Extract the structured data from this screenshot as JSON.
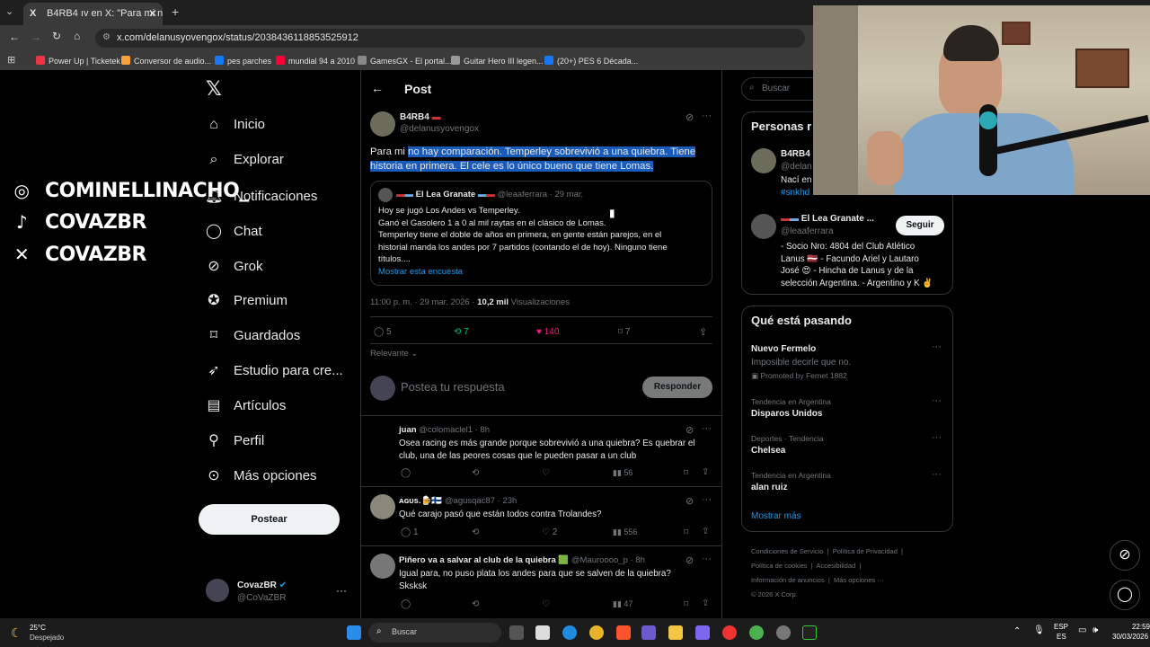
{
  "browser": {
    "tab_title": "B4RB4 ıv en X: \"Para mi no hay",
    "url": "x.com/delanusyovengox/status/2038436118853525912",
    "bookmarks": [
      "Power Up | Ticketek",
      "Conversor de audio...",
      "pes parches",
      "mundial 94 a 2010",
      "GamesGX - El portal...",
      "Guitar Hero III legen...",
      "(20+) PES 6 Década..."
    ]
  },
  "overlay": {
    "instagram": "COMINELLINACHO_",
    "tiktok": "COVAZBR",
    "x": "COVAZBR"
  },
  "nav": {
    "items": [
      "Inicio",
      "Explorar",
      "Notificaciones",
      "Chat",
      "Grok",
      "Premium",
      "Guardados",
      "Estudio para cre...",
      "Artículos",
      "Perfil",
      "Más opciones"
    ],
    "post_button": "Postear",
    "account_name": "CovazBR",
    "account_handle": "@CoVaZBR"
  },
  "post": {
    "header": "Post",
    "author": "B4RB4",
    "handle": "@delanusyovengox",
    "text_plain": "Para mi ",
    "text_selected_1": "no hay comparación. Temperley sobrevivió a una quiebra. Tiene",
    "text_selected_2": "historia en primera. El cele es lo único bueno que tiene Lomas.",
    "quote_author": "El Lea Granate",
    "quote_meta": "@leaaferrara · 29 mar.",
    "quote_line1": "Hoy se jugó Los Andes vs Temperley.",
    "quote_line2": "Ganó el Gasolero 1 a 0 al mil raytas en el clásico de Lomas.",
    "quote_line3": "Temperley tiene el doble de años en primera, en gente están parejos, en el",
    "quote_line4": "historial manda los andes por 7 partidos (contando el de hoy). Ninguno tiene",
    "quote_line5": "títulos....",
    "quote_poll": "Mostrar esta encuesta",
    "time": "11:00 p. m. · 29 mar. 2026 · ",
    "views": "10,2 mil",
    "views_label": " Visualizaciones",
    "replies": "5",
    "reposts": "7",
    "likes": "140",
    "bookmarks": "7",
    "sort": "Relevante",
    "reply_placeholder": "Postea tu respuesta",
    "reply_button": "Responder"
  },
  "replies": [
    {
      "name": "juan",
      "meta": "@colomaclel1 · 8h",
      "line1": "Osea racing es más grande porque sobrevivió a una quiebra? Es quebrar el",
      "line2": "club, una de las peores cosas que le pueden pasar a un club",
      "replies": "",
      "reposts": "",
      "likes": "",
      "views": "56"
    },
    {
      "name": "ᴀɢᴜs.🍺🇫🇮",
      "meta": "@agusqac87 · 23h",
      "line1": "Qué carajo pasó que están todos contra Trolandes?",
      "line2": "",
      "replies": "1",
      "reposts": "",
      "likes": "2",
      "views": "556"
    },
    {
      "name": "Piñero va a salvar al club de la quiebra 🟩",
      "meta": "@Mauroooo_p · 8h",
      "line1": "Igual para, no puso plata los andes para que se salven de la quiebra?",
      "line2": "Sksksk",
      "replies": "",
      "reposts": "",
      "likes": "",
      "views": "47"
    }
  ],
  "right": {
    "search_placeholder": "Buscar",
    "people_title": "Personas r",
    "p1_name": "B4RB4",
    "p1_handle": "@delan",
    "p1_bio": "Nací en",
    "p1_tag": "#snkhd",
    "p2_name": "El Lea Granate ...",
    "p2_handle": "@leaaferrara",
    "p2_follow": "Seguir",
    "p2_bio1": "- Socio Nro: 4804 del Club Atlético",
    "p2_bio2": "Lanus 🇱🇻 - Facundo Ariel y Lautaro",
    "p2_bio3": "José 😍 - Hincha de Lanus y de la",
    "p2_bio4": "selección Argentina. - Argentino y K ✌️",
    "trends_title": "Qué está pasando",
    "trends": [
      {
        "context": "",
        "name": "Nuevo Fermelo",
        "sub": "Imposible decirle que no.",
        "promo": "Promoted by Fernet 1882"
      },
      {
        "context": "Tendencia en Argentina",
        "name": "Disparos Unidos",
        "sub": "",
        "promo": ""
      },
      {
        "context": "Deportes · Tendencia",
        "name": "Chelsea",
        "sub": "",
        "promo": ""
      },
      {
        "context": "Tendencia en Argentina",
        "name": "alan ruiz",
        "sub": "",
        "promo": ""
      }
    ],
    "show_more": "Mostrar más",
    "footer1": "Condiciones de Servicio  |  Política de Privacidad  |",
    "footer2": "Política de cookies  |  Accesibilidad  |",
    "footer3": "Información de anuncios  |  Más opciones ···",
    "footer4": "© 2026 X Corp."
  },
  "taskbar": {
    "temp": "25°C",
    "weather": "Despejado",
    "search": "Buscar",
    "lang1": "ESP",
    "lang2": "ES",
    "time": "22:59",
    "date": "30/03/2026"
  }
}
